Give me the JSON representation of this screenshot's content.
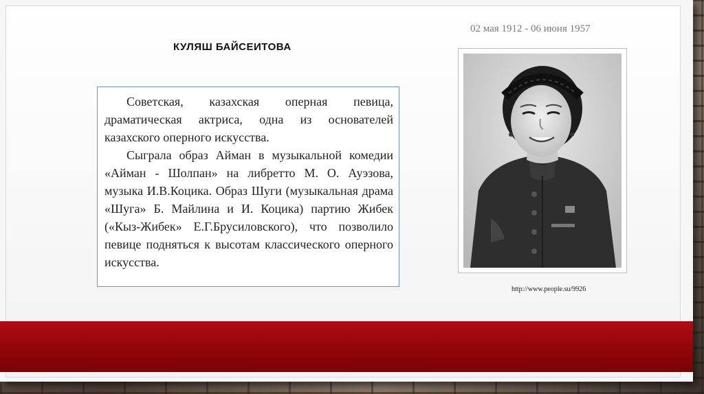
{
  "slide": {
    "dates": "02 мая 1912 - 06 июня 1957",
    "title": "КУЛЯШ БАЙСЕИТОВА",
    "bio": {
      "paragraph1": "Советская, казахская оперная певица, драматическая актриса, одна из основателей казахского оперного искусства.",
      "paragraph2": "Сыграла образ Айман в музыкальной комедии «Айман - Шолпан» на либретто М. О. Ауэзова, музыка И.В.Коцика. Образ Шуги (музыкальная драма «Шуга» Б. Майлина и И. Коцика) партию Жибек («Кыз-Жибек» Е.Г.Брусиловского), что позволило певице подняться к высотам классического оперного искусства."
    },
    "photo_source": "http://www.people.su/9926"
  },
  "colors": {
    "accent_red": "#9a070c",
    "box_border": "#6e93b8",
    "dates_text": "#7a7a7a"
  }
}
